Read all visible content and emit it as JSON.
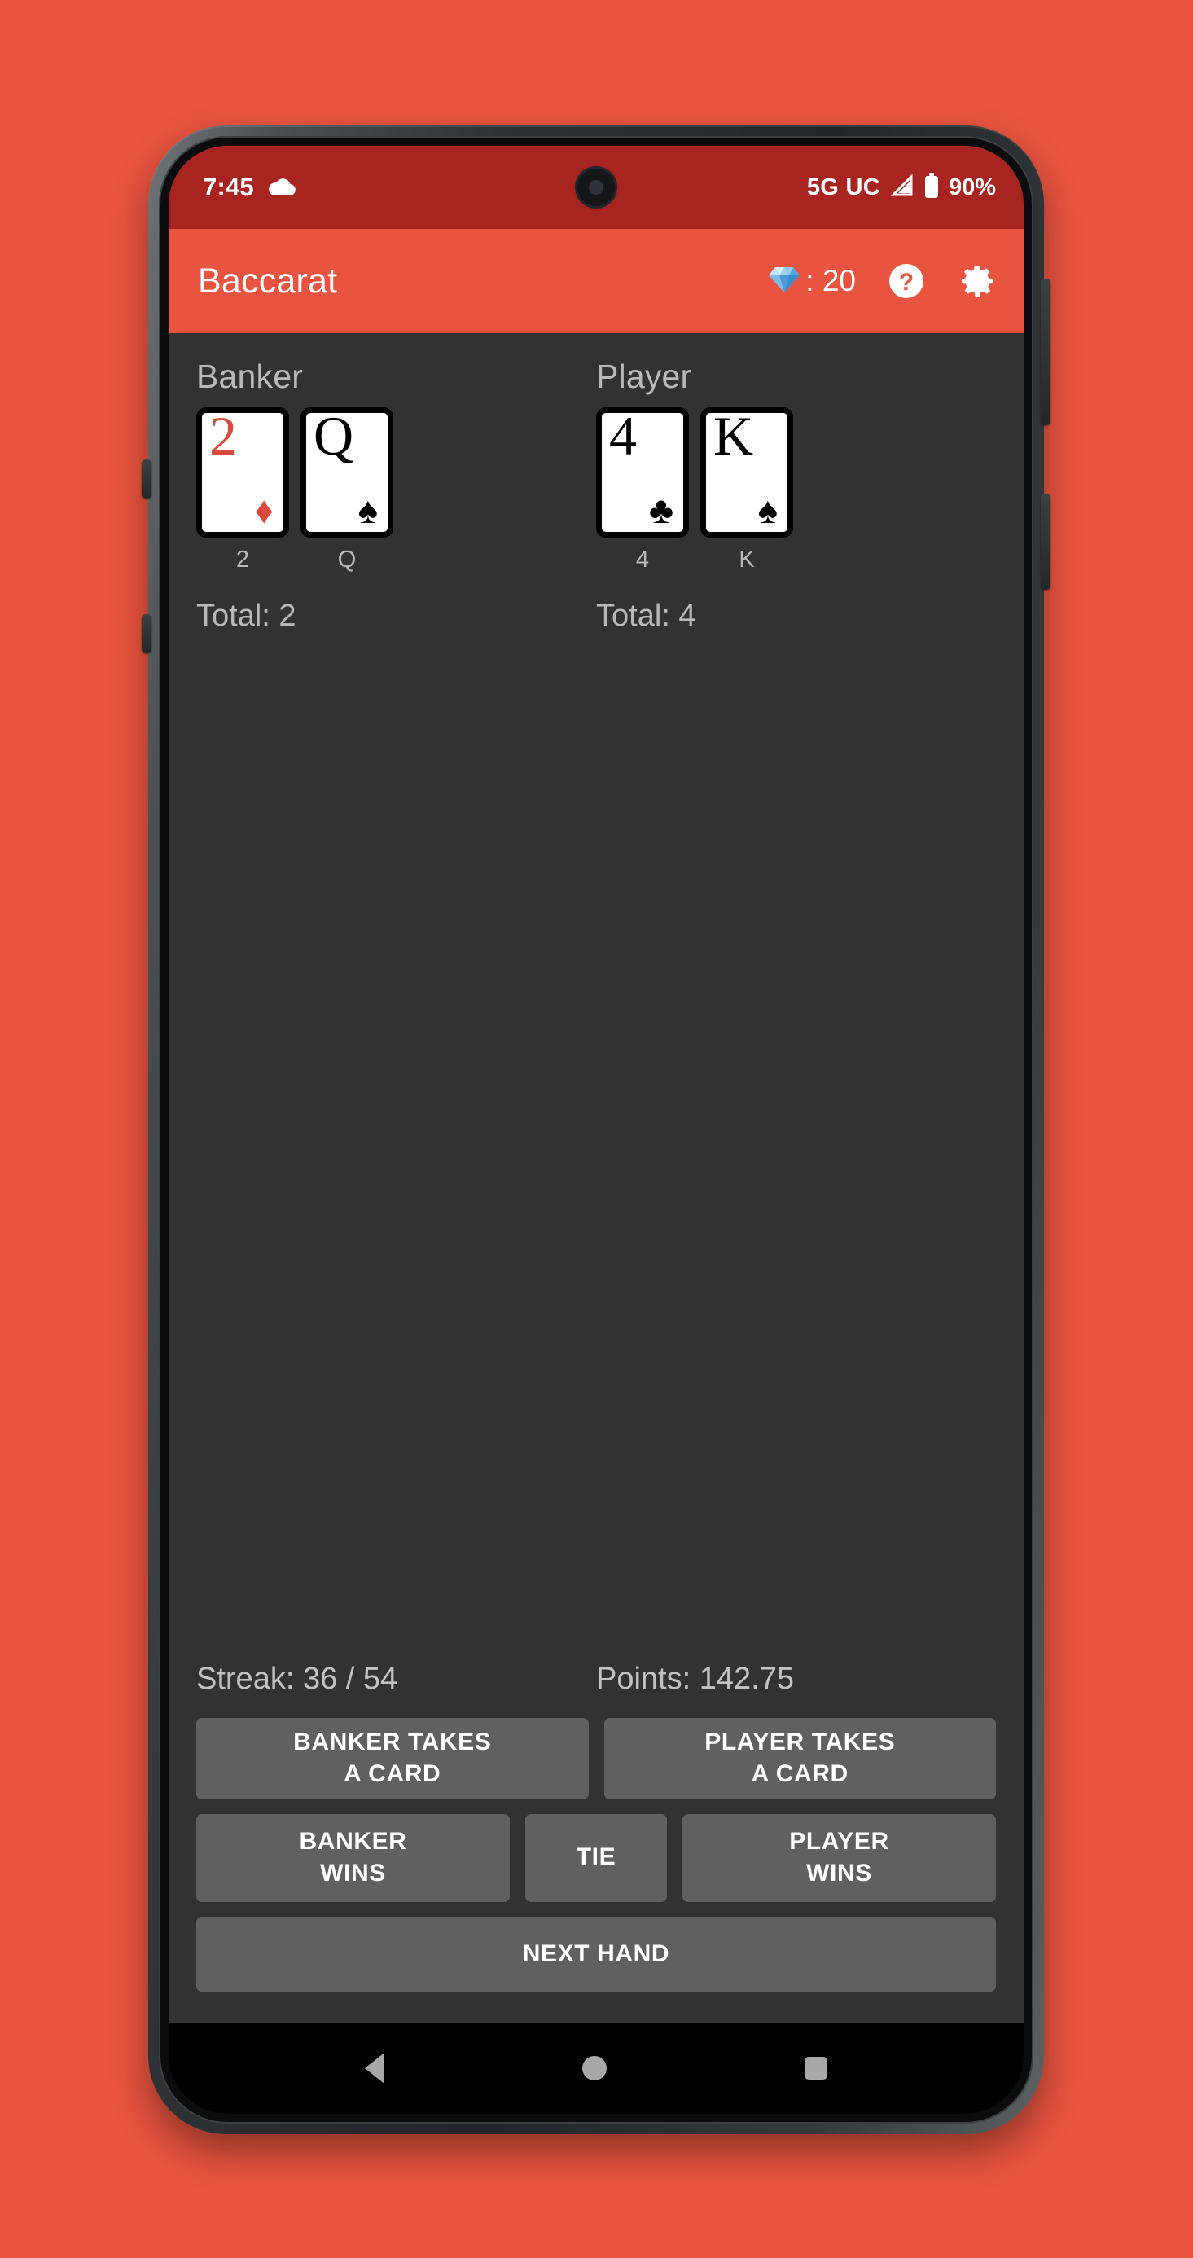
{
  "status_bar": {
    "time": "7:45",
    "cloud_icon": "cloud-icon",
    "network": "5G UC",
    "signal_icon": "signal-triangle-icon",
    "battery_icon": "battery-icon",
    "battery_percent": "90%"
  },
  "app_bar": {
    "title": "Baccarat",
    "gem_icon": "gem-icon",
    "gem_label": ": 20",
    "help_icon": "help-circle-icon",
    "settings_icon": "gear-icon"
  },
  "game": {
    "banker": {
      "title": "Banker",
      "total": "Total: 2",
      "cards": [
        {
          "rank": "2",
          "suit": "♦",
          "color": "red",
          "caption": "2"
        },
        {
          "rank": "Q",
          "suit": "♠",
          "color": "black",
          "caption": "Q"
        }
      ]
    },
    "player": {
      "title": "Player",
      "total": "Total: 4",
      "cards": [
        {
          "rank": "4",
          "suit": "♣",
          "color": "black",
          "caption": "4"
        },
        {
          "rank": "K",
          "suit": "♠",
          "color": "black",
          "caption": "K"
        }
      ]
    },
    "stats": {
      "streak": "Streak: 36 / 54",
      "points": "Points: 142.75"
    },
    "buttons": {
      "banker_takes_card": "BANKER TAKES\nA CARD",
      "player_takes_card": "PLAYER TAKES\nA CARD",
      "banker_wins": "BANKER\nWINS",
      "tie": "TIE",
      "player_wins": "PLAYER\nWINS",
      "next_hand": "NEXT HAND"
    }
  },
  "nav_bar": {
    "back_icon": "back-triangle-icon",
    "home_icon": "home-circle-icon",
    "recents_icon": "recents-square-icon"
  },
  "colors": {
    "brand": "#e8543f",
    "status_bar": "#a82420",
    "surface": "#323232",
    "button": "#5f6062",
    "card_red": "#d9493c"
  }
}
